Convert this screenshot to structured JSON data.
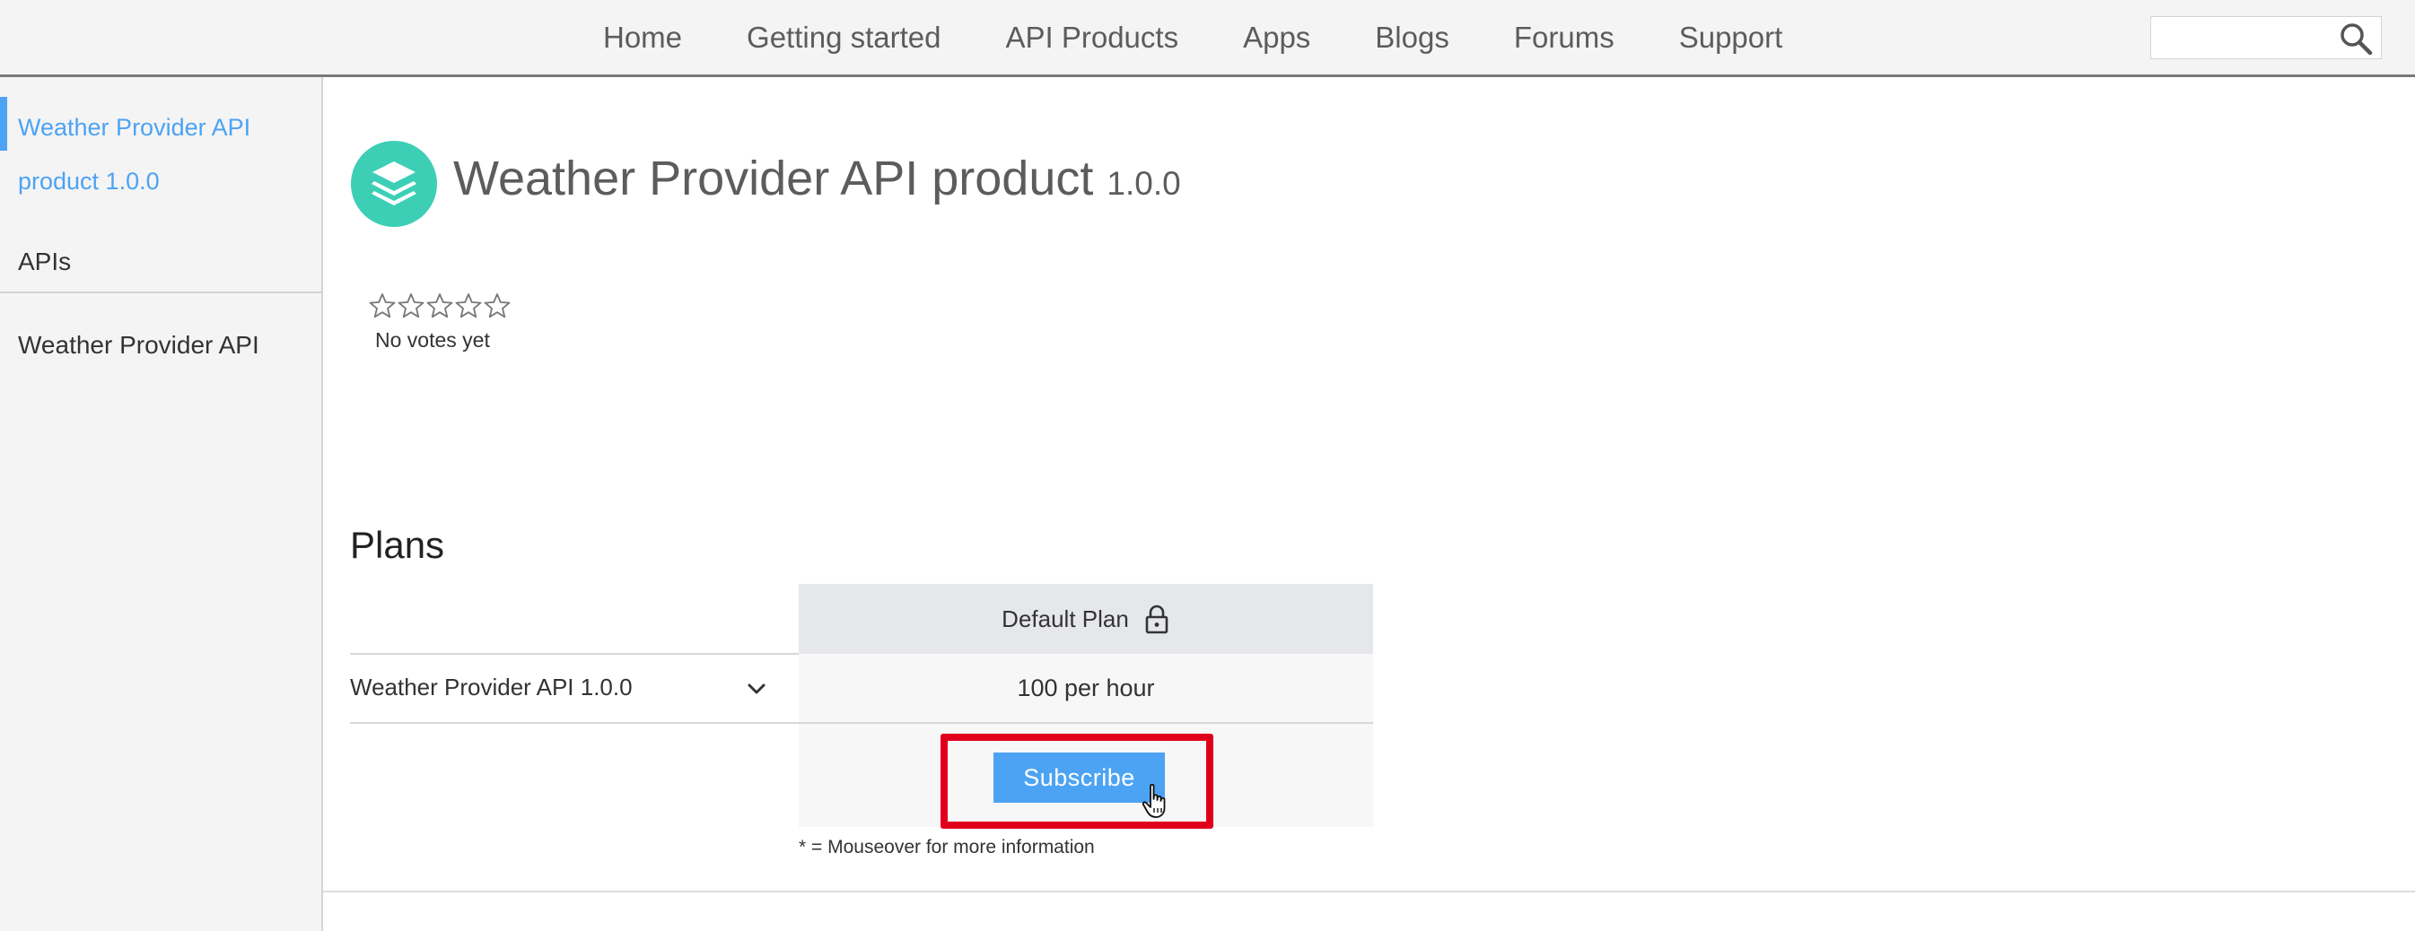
{
  "nav": {
    "links": [
      "Home",
      "Getting started",
      "API Products",
      "Apps",
      "Blogs",
      "Forums",
      "Support"
    ],
    "search": {
      "value": "",
      "placeholder": "",
      "icon": "search-icon"
    }
  },
  "sidebar": {
    "product_link": "Weather Provider API product 1.0.0",
    "apis_heading": "APIs",
    "api_items": [
      "Weather Provider API"
    ],
    "accent_color": "#4da3f3"
  },
  "product": {
    "name": "Weather Provider API product",
    "version": "1.0.0",
    "logo_icon": "stacked-layers-icon",
    "logo_color": "#3ccfb6",
    "rating": {
      "stars_total": 5,
      "stars_filled": 0,
      "votes_text": "No votes yet"
    }
  },
  "plans": {
    "heading": "Plans",
    "plan_name": "Default Plan",
    "plan_icon": "lock-icon",
    "api_row": {
      "label": "Weather Provider API 1.0.0",
      "rate_limit": "100 per hour"
    },
    "subscribe_label": "Subscribe",
    "footnote": "* = Mouseover for more information",
    "highlight_color": "#e0001b"
  }
}
